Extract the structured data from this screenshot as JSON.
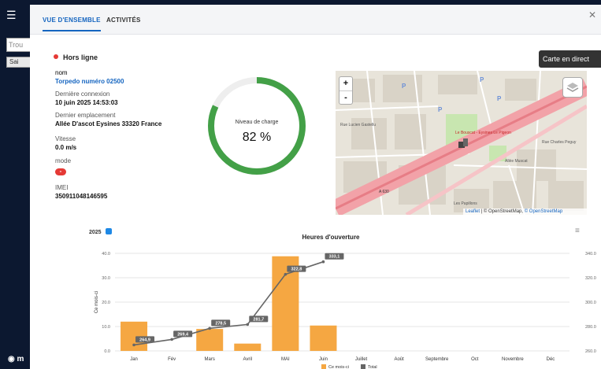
{
  "background": {
    "search_placeholder": "Trou",
    "button_label": "Sai",
    "logo_text": "m"
  },
  "tabs": [
    {
      "label": "VUE D'ENSEMBLE",
      "active": true
    },
    {
      "label": "ACTIVITÉS",
      "active": false
    }
  ],
  "status": {
    "label": "Hors ligne",
    "color": "#e53935"
  },
  "info": {
    "name_label": "nom",
    "name_value": "Torpedo numéro 02500",
    "last_connection_label": "Dernière connexion",
    "last_connection_value": "10 juin 2025 14:53:03",
    "last_location_label": "Dernier emplacement",
    "last_location_value": "Allée D'ascot Eysines 33320 France",
    "speed_label": "Vitesse",
    "speed_value": "0.0 m/s",
    "mode_label": "mode",
    "mode_value": "-",
    "imei_label": "IMEI",
    "imei_value": "350911048146595"
  },
  "gauge": {
    "label": "Niveau de charge",
    "value_text": "82 %",
    "value": 82,
    "color": "#43a047"
  },
  "map": {
    "live_button": "Carte en direct",
    "zoom_in": "+",
    "zoom_out": "-",
    "attribution_leaflet": "Leaflet",
    "attribution_osm": "© OpenStreetMap,",
    "attribution_osm2": "© OpenStreetMap",
    "labels": [
      "Le Bouscat - Eysines Le Pigeon",
      "Allée Muscat",
      "A 630",
      "Les Papillons",
      "Rue Charles Peguy",
      "Rue Lucien Gastellu"
    ]
  },
  "chart_data": {
    "type": "bar",
    "title": "Heures d'ouverture",
    "year": "2025",
    "categories": [
      "Jan",
      "Fév",
      "Mars",
      "Avril",
      "MAI",
      "Juin",
      "Juillet",
      "Août",
      "Septembre",
      "Oct",
      "Novembre",
      "Déc"
    ],
    "series": [
      {
        "name": "Ce mois-ci",
        "type": "bar",
        "axis": "left",
        "color": "#f5a742",
        "values": [
          12.0,
          0,
          9.0,
          3.0,
          38.8,
          10.4,
          0,
          0,
          0,
          0,
          0,
          0
        ]
      },
      {
        "name": "Total",
        "type": "line",
        "axis": "right",
        "color": "#666666",
        "values": [
          264.9,
          269.4,
          278.5,
          281.7,
          322.8,
          333.1,
          null,
          null,
          null,
          null,
          null,
          null
        ]
      }
    ],
    "data_labels": [
      "264,9",
      "269,4",
      "278,5",
      "281,7",
      "322,8",
      "333,1"
    ],
    "ylabel": "Ce mois-ci",
    "y2label": "Total",
    "ylim": [
      0,
      40
    ],
    "y2lim": [
      260,
      340
    ],
    "yticks": [
      "0.0",
      "10.0",
      "20.0",
      "30.0",
      "40.0"
    ],
    "y2ticks": [
      "260.0",
      "280.0",
      "300.0",
      "320.0",
      "340.0"
    ],
    "grid": true,
    "legend_placement": "bottom"
  }
}
